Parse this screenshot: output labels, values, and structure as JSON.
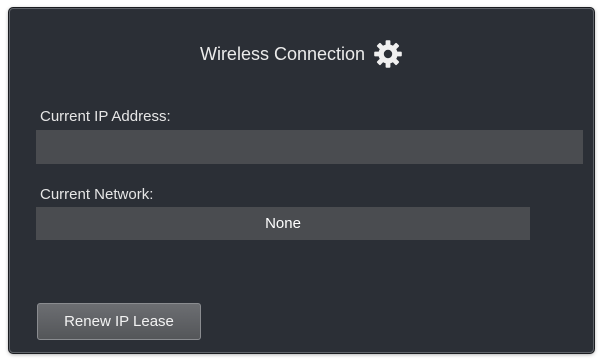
{
  "panel": {
    "title": "Wireless Connection",
    "icon": "gear-icon"
  },
  "ip_address": {
    "label": "Current IP Address:",
    "value": ""
  },
  "network": {
    "label": "Current Network:",
    "value": "None"
  },
  "actions": {
    "renew_label": "Renew IP Lease"
  },
  "colors": {
    "panel_background": "#2b2f36",
    "field_background": "#4a4c50",
    "button_background": "#606266",
    "text": "#ebebeb"
  }
}
